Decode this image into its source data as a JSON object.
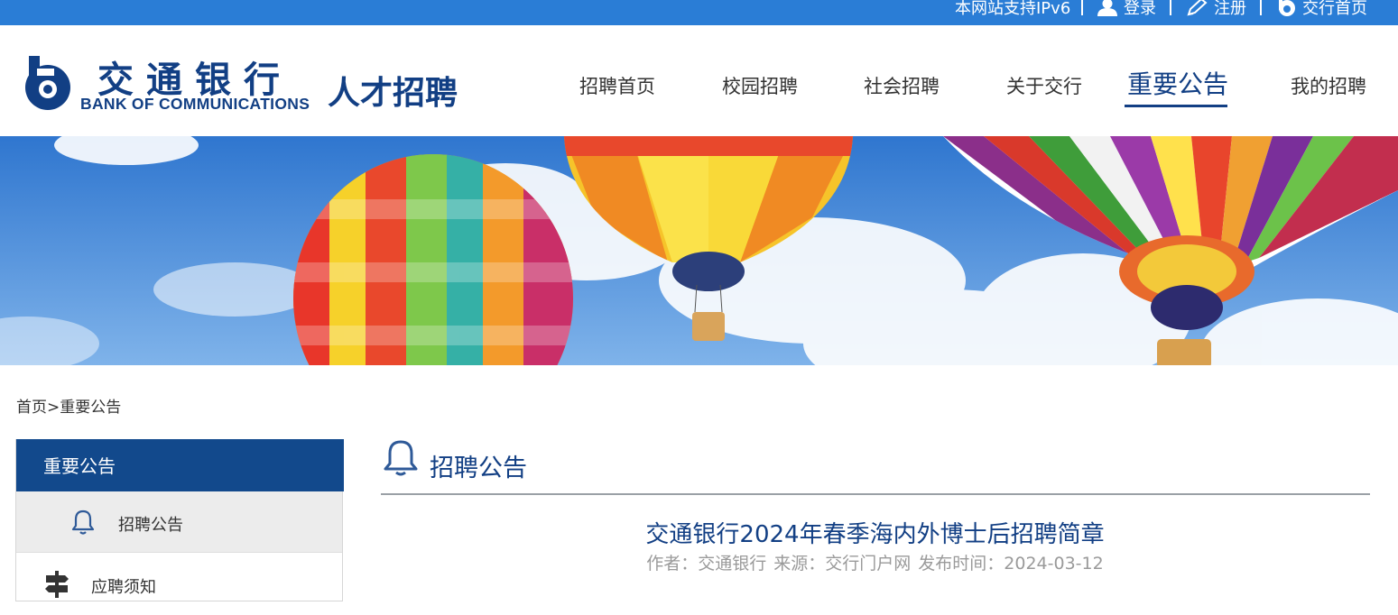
{
  "topbar": {
    "ipv6_label": "本网站支持IPv6",
    "login_label": "登录",
    "register_label": "注册",
    "home_label": "交行首页"
  },
  "header": {
    "logo_cn": "交通银行",
    "logo_en": "BANK OF COMMUNICATIONS",
    "logo_sub": "人才招聘"
  },
  "nav": {
    "items": [
      {
        "label": "招聘首页"
      },
      {
        "label": "校园招聘"
      },
      {
        "label": "社会招聘"
      },
      {
        "label": "关于交行"
      },
      {
        "label": "重要公告",
        "active": true
      },
      {
        "label": "我的招聘"
      }
    ]
  },
  "breadcrumb": {
    "home": "首页",
    "sep": ">",
    "current": "重要公告"
  },
  "sidebar": {
    "title": "重要公告",
    "items": [
      {
        "label": "招聘公告",
        "icon": "bell-icon",
        "active": true
      },
      {
        "label": "应聘须知",
        "icon": "signpost-icon"
      }
    ]
  },
  "main": {
    "section_title": "招聘公告",
    "section_icon": "bell-icon",
    "article": {
      "title": "交通银行2024年春季海内外博士后招聘简章",
      "author": "作者：交通银行",
      "source": "来源：交行门户网",
      "published": "发布时间：2024-03-12"
    }
  },
  "colors": {
    "topbar": "#2a7dd6",
    "brand": "#123f84",
    "sidebar_header": "#12498c",
    "meta_text": "#9a9a9a"
  }
}
